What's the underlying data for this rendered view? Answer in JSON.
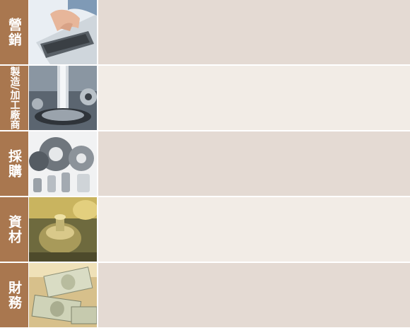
{
  "rows": [
    {
      "label": "營銷",
      "image": "laptop-typing-photo"
    },
    {
      "label": "製造/加工廠商",
      "image": "machining-tool-photo"
    },
    {
      "label": "採購",
      "image": "gears-and-bushings-photo"
    },
    {
      "label": "資材",
      "image": "valve-fitting-photo"
    },
    {
      "label": "財務",
      "image": "dollar-bills-photo"
    }
  ],
  "colors": {
    "label_bg": "#a9774f",
    "panel_dark": "#e4dad3",
    "panel_light": "#f2ece6"
  }
}
